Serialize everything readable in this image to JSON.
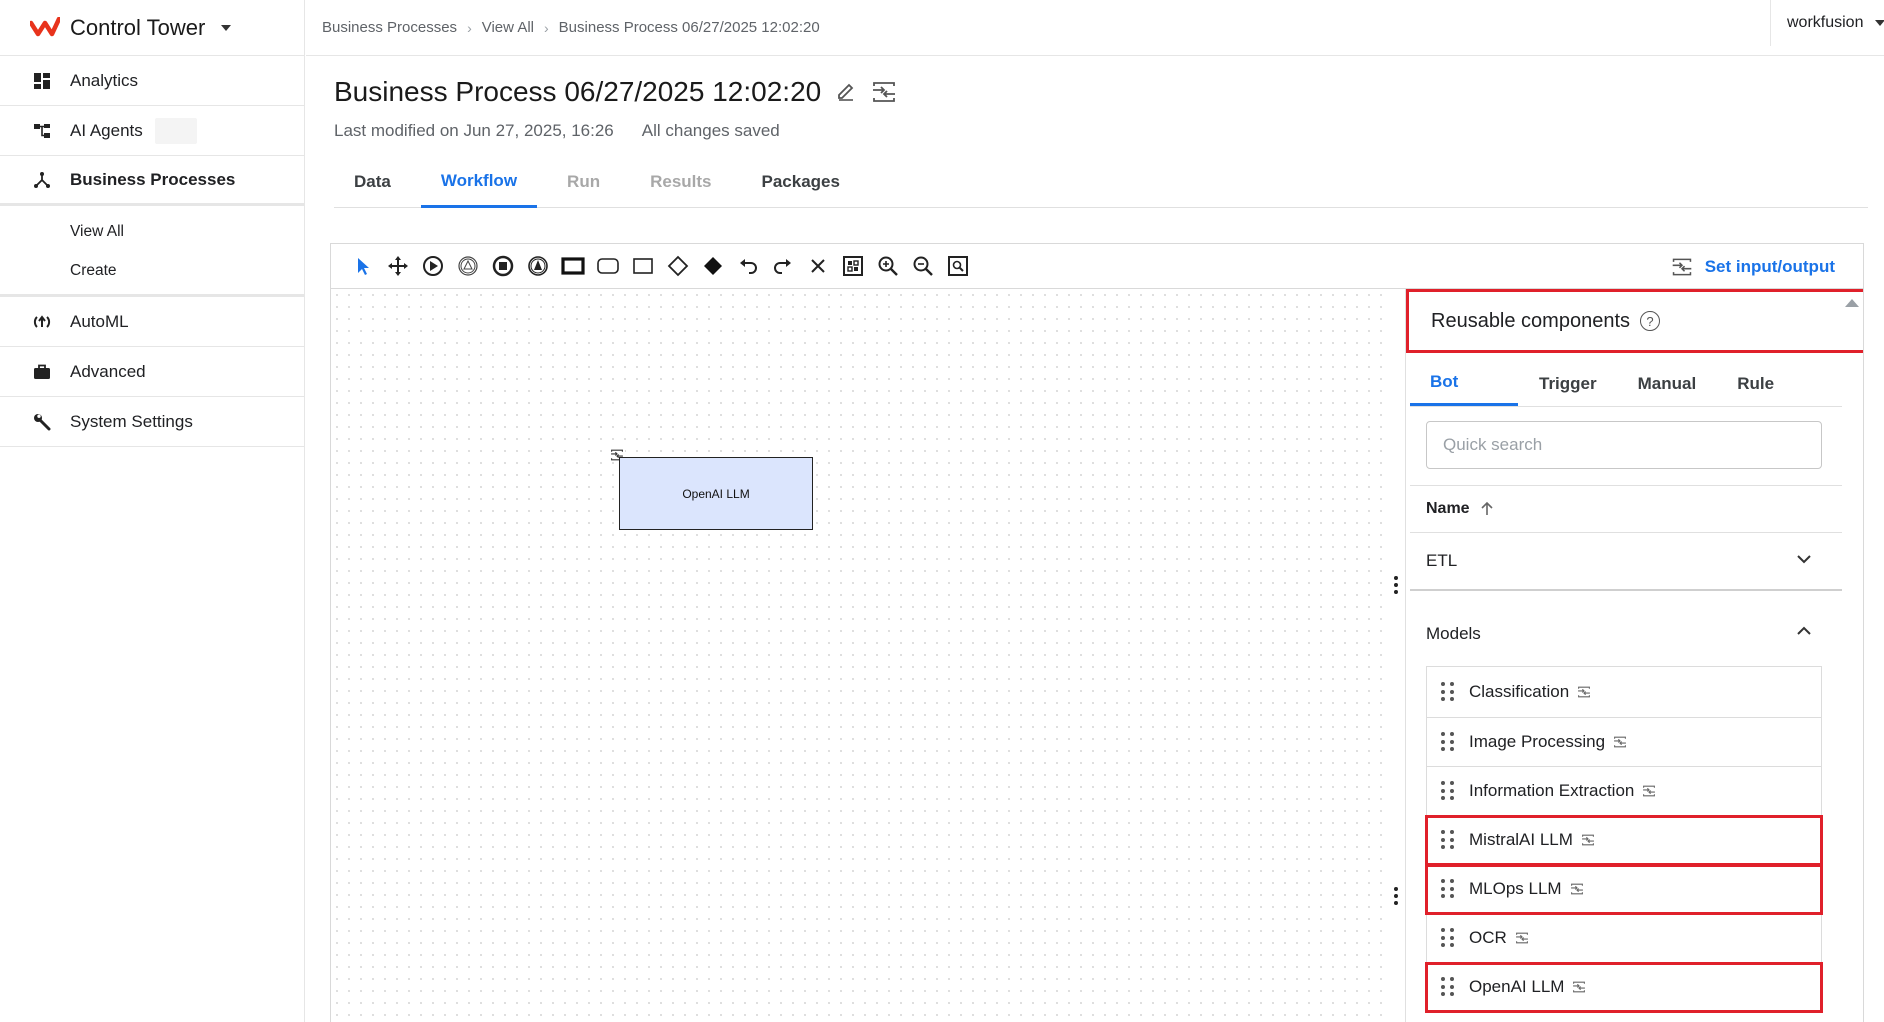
{
  "app": {
    "name": "Control Tower",
    "brand_color": "#e8331c",
    "accent_color": "#1a73e8",
    "highlight_color": "#e0202a"
  },
  "sidebar": {
    "items": [
      {
        "label": "Analytics",
        "icon": "dashboard-icon"
      },
      {
        "label": "AI Agents",
        "icon": "hierarchy-icon"
      },
      {
        "label": "Business Processes",
        "icon": "process-fork-icon",
        "active": true
      },
      {
        "label": "AutoML",
        "icon": "automl-icon"
      },
      {
        "label": "Advanced",
        "icon": "briefcase-icon"
      },
      {
        "label": "System Settings",
        "icon": "wrench-icon"
      }
    ],
    "sub_items": [
      {
        "label": "View All"
      },
      {
        "label": "Create"
      }
    ]
  },
  "breadcrumb": [
    "Business Processes",
    "View All",
    "Business Process 06/27/2025 12:02:20"
  ],
  "user": {
    "name": "workfusion"
  },
  "header": {
    "title": "Business Process 06/27/2025 12:02:20",
    "last_modified": "Last modified on Jun 27, 2025, 16:26",
    "save_status": "All changes saved"
  },
  "tabs": [
    {
      "label": "Data",
      "state": "normal"
    },
    {
      "label": "Workflow",
      "state": "active"
    },
    {
      "label": "Run",
      "state": "disabled"
    },
    {
      "label": "Results",
      "state": "disabled"
    },
    {
      "label": "Packages",
      "state": "normal"
    }
  ],
  "toolbar": {
    "tools": [
      "select-pointer-icon",
      "move-icon",
      "start-event-icon",
      "signal-event-icon",
      "end-event-icon",
      "escalation-event-icon",
      "task-thick-icon",
      "subprocess-icon",
      "task-icon",
      "gateway-icon",
      "gateway-filled-icon",
      "undo-icon",
      "redo-icon",
      "delete-icon",
      "fit-icon",
      "zoom-in-icon",
      "zoom-out-icon",
      "zoom-reset-icon"
    ],
    "set_io_label": "Set input/output"
  },
  "canvas": {
    "nodes": [
      {
        "label": "OpenAI LLM"
      }
    ]
  },
  "panel": {
    "title": "Reusable components",
    "tabs": [
      {
        "label": "Bot",
        "active": true
      },
      {
        "label": "Trigger"
      },
      {
        "label": "Manual"
      },
      {
        "label": "Rule"
      }
    ],
    "search_placeholder": "Quick search",
    "sort_label": "Name",
    "groups": [
      {
        "label": "ETL",
        "expanded": false
      },
      {
        "label": "Models",
        "expanded": true
      }
    ],
    "model_items": [
      {
        "label": "Classification",
        "highlighted": false
      },
      {
        "label": "Image Processing",
        "highlighted": false
      },
      {
        "label": "Information Extraction",
        "highlighted": false
      },
      {
        "label": "MistralAI LLM",
        "highlighted": true
      },
      {
        "label": "MLOps LLM",
        "highlighted": true
      },
      {
        "label": "OCR",
        "highlighted": false
      },
      {
        "label": "OpenAI LLM",
        "highlighted": true
      }
    ]
  }
}
